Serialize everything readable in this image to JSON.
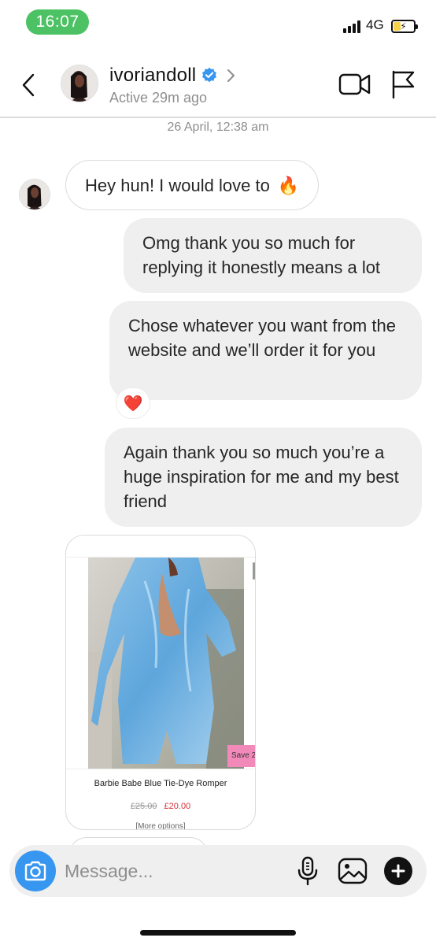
{
  "status_bar": {
    "time": "16:07",
    "network": "4G",
    "battery_level": 0.35,
    "battery_color": "#f6d24a",
    "time_pill_color": "#4cc264"
  },
  "header": {
    "username": "ivoriandoll",
    "active_status": "Active 29m ago",
    "verified": true,
    "verified_color": "#3797f0",
    "back_icon": "chevron-left-icon",
    "video_icon": "video-call-icon",
    "flag_icon": "report-flag-icon"
  },
  "chat": {
    "timestamp": "26 April, 12:38 am",
    "messages": [
      {
        "direction": "in",
        "text": "Hey hun! I would love to",
        "emoji": "🔥"
      },
      {
        "direction": "out",
        "text": "Omg thank you so much for replying it honestly means a lot"
      },
      {
        "direction": "out",
        "text": "Chose whatever you want from the website and we’ll order it for you",
        "reaction": "❤️"
      },
      {
        "direction": "out",
        "text": "Again thank you so much you’re a huge inspiration for me and my best friend"
      }
    ],
    "shared_product": {
      "save_badge": "Save 2",
      "name": "Barbie Babe Blue Tie-Dye Romper",
      "old_price": "£25.00",
      "new_price": "£20.00",
      "more_options": "[More options]"
    }
  },
  "composer": {
    "placeholder": "Message...",
    "camera_color": "#3797f0"
  }
}
